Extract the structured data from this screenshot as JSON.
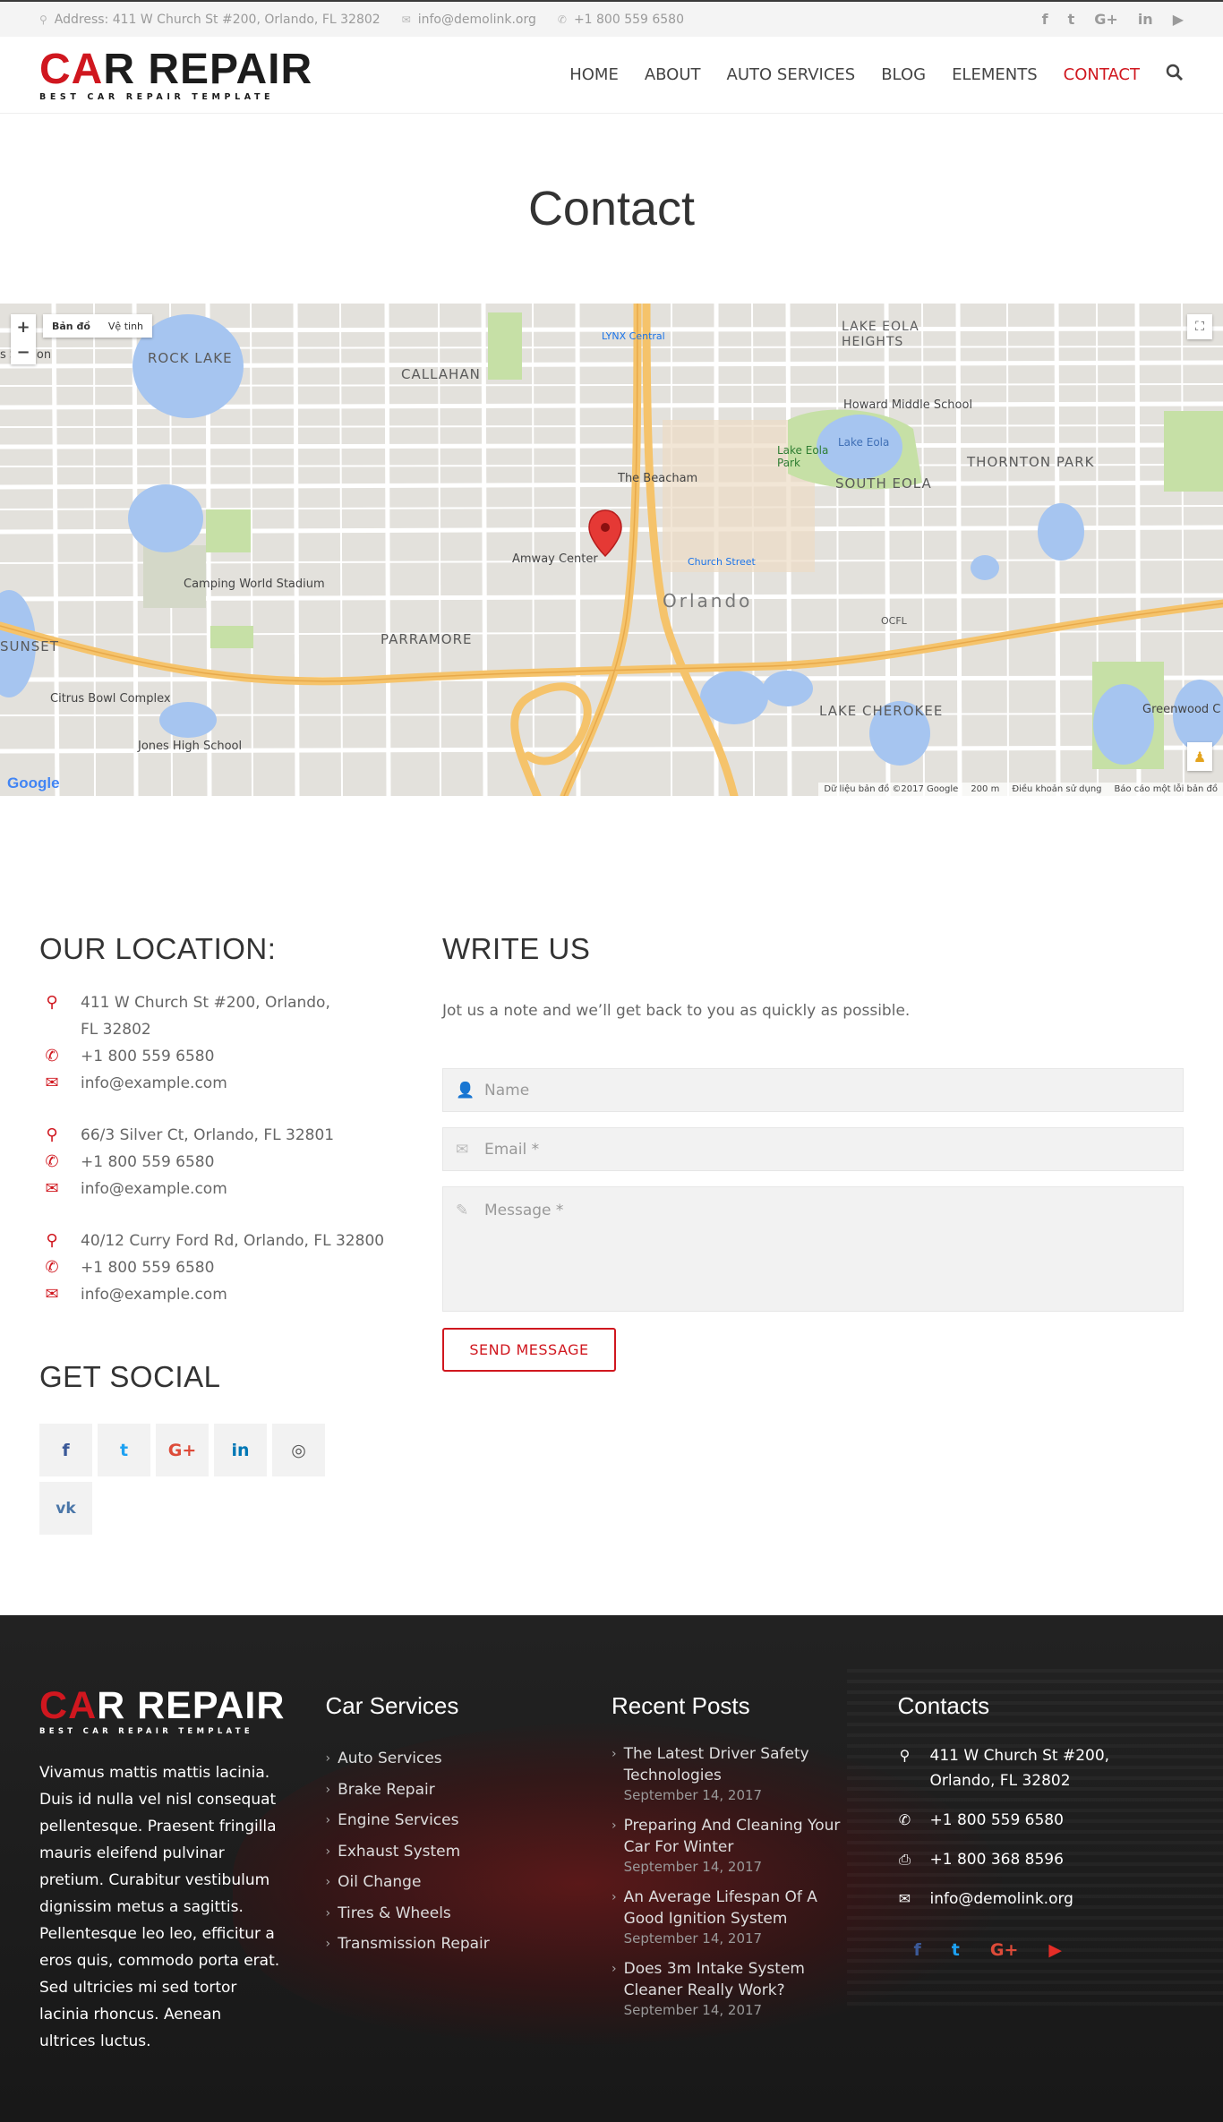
{
  "topbar": {
    "address": "Address: 411 W Church St #200, Orlando, FL 32802",
    "email": "info@demolink.org",
    "phone": "+1 800 559 6580",
    "social": [
      "f",
      "t",
      "G+",
      "in",
      "▶"
    ]
  },
  "header": {
    "logo_main_a": "C",
    "logo_main_b": "A",
    "logo_main_c": "R REPAIR",
    "logo_tag": "BEST CAR REPAIR TEMPLATE",
    "nav": [
      "HOME",
      "ABOUT",
      "AUTO SERVICES",
      "BLOG",
      "ELEMENTS",
      "CONTACT"
    ]
  },
  "page_title": "Contact",
  "map": {
    "zoom_in": "+",
    "zoom_out": "−",
    "type_map": "Bản đồ",
    "type_sat": "Vệ tinh",
    "google": "Google",
    "attrib_data": "Dữ liệu bản đồ ©2017 Google",
    "attrib_scale": "200 m",
    "attrib_terms": "Điều khoản sử dụng",
    "attrib_report": "Báo cáo một lỗi bản đồ",
    "labels": {
      "rock_lake": "ROCK LAKE",
      "callahan": "CALLAHAN",
      "lake_eola_heights": "LAKE EOLA HEIGHTS",
      "howard": "Howard Middle School",
      "thornton": "THORNTON PARK",
      "south_eola": "SOUTH EOLA",
      "beacham": "The Beacham",
      "amway": "Amway Center",
      "church_street": "Church Street",
      "orlando": "Orlando",
      "camping": "Camping World Stadium",
      "parramore": "PARRAMORE",
      "sunset": "SUNSET",
      "citrus": "Citrus Bowl Complex",
      "jones": "Jones High School",
      "lake_cherokee": "LAKE CHEROKEE",
      "greenwood": "Greenwood C",
      "lynx": "LYNX Central",
      "lake_eola_park": "Lake Eola Park",
      "lake_eola": "Lake Eola",
      "ocfl": "OCFL",
      "station": "s Station"
    }
  },
  "location": {
    "heading": "OUR LOCATION:",
    "groups": [
      {
        "address": "411 W Church St #200, Orlando, FL 32802",
        "phone": "+1 800 559 6580",
        "email": "info@example.com"
      },
      {
        "address": "66/3 Silver Ct, Orlando, FL 32801",
        "phone": "+1 800 559 6580",
        "email": "info@example.com"
      },
      {
        "address": "40/12 Curry Ford Rd, Orlando, FL 32800",
        "phone": "+1 800 559 6580",
        "email": "info@example.com"
      }
    ]
  },
  "social": {
    "heading": "GET SOCIAL",
    "items": [
      "f",
      "t",
      "G+",
      "in",
      "◎",
      "vk"
    ]
  },
  "write_us": {
    "heading": "WRITE US",
    "intro": "Jot us a note and we’ll get back to you as quickly as possible.",
    "name_placeholder": "Name",
    "email_placeholder": "Email *",
    "message_placeholder": "Message *",
    "send_label": "SEND MESSAGE"
  },
  "footer": {
    "about": "Vivamus mattis mattis lacinia. Duis id nulla vel nisl consequat pellentesque. Praesent fringilla mauris eleifend pulvinar pretium. Curabitur vestibulum dignissim metus a sagittis. Pellentesque leo leo, efficitur a eros quis, commodo porta erat. Sed ultricies mi sed tortor lacinia rhoncus. Aenean ultrices luctus.",
    "services_heading": "Car Services",
    "services": [
      "Auto Services",
      "Brake Repair",
      "Engine Services",
      "Exhaust System",
      "Oil Change",
      "Tires & Wheels",
      "Transmission Repair"
    ],
    "posts_heading": "Recent Posts",
    "posts": [
      {
        "title": "The Latest Driver Safety Technologies",
        "date": "September 14, 2017"
      },
      {
        "title": "Preparing And Cleaning Your Car For Winter",
        "date": "September 14, 2017"
      },
      {
        "title": "An Average Lifespan Of A Good Ignition System",
        "date": "September 14, 2017"
      },
      {
        "title": "Does 3m Intake System Cleaner Really Work?",
        "date": "September 14, 2017"
      }
    ],
    "contacts_heading": "Contacts",
    "address": "411 W Church St #200, Orlando, FL 32802",
    "phone": "+1 800 559 6580",
    "fax": "+1 800 368 8596",
    "email": "info@demolink.org",
    "social": [
      "f",
      "t",
      "G+",
      "▶"
    ]
  },
  "colors": {
    "accent": "#d0171f",
    "facebook": "#3b5998",
    "twitter": "#1da1f2",
    "google": "#dd4b39",
    "linkedin": "#0077b5",
    "youtube": "#e52d27"
  }
}
